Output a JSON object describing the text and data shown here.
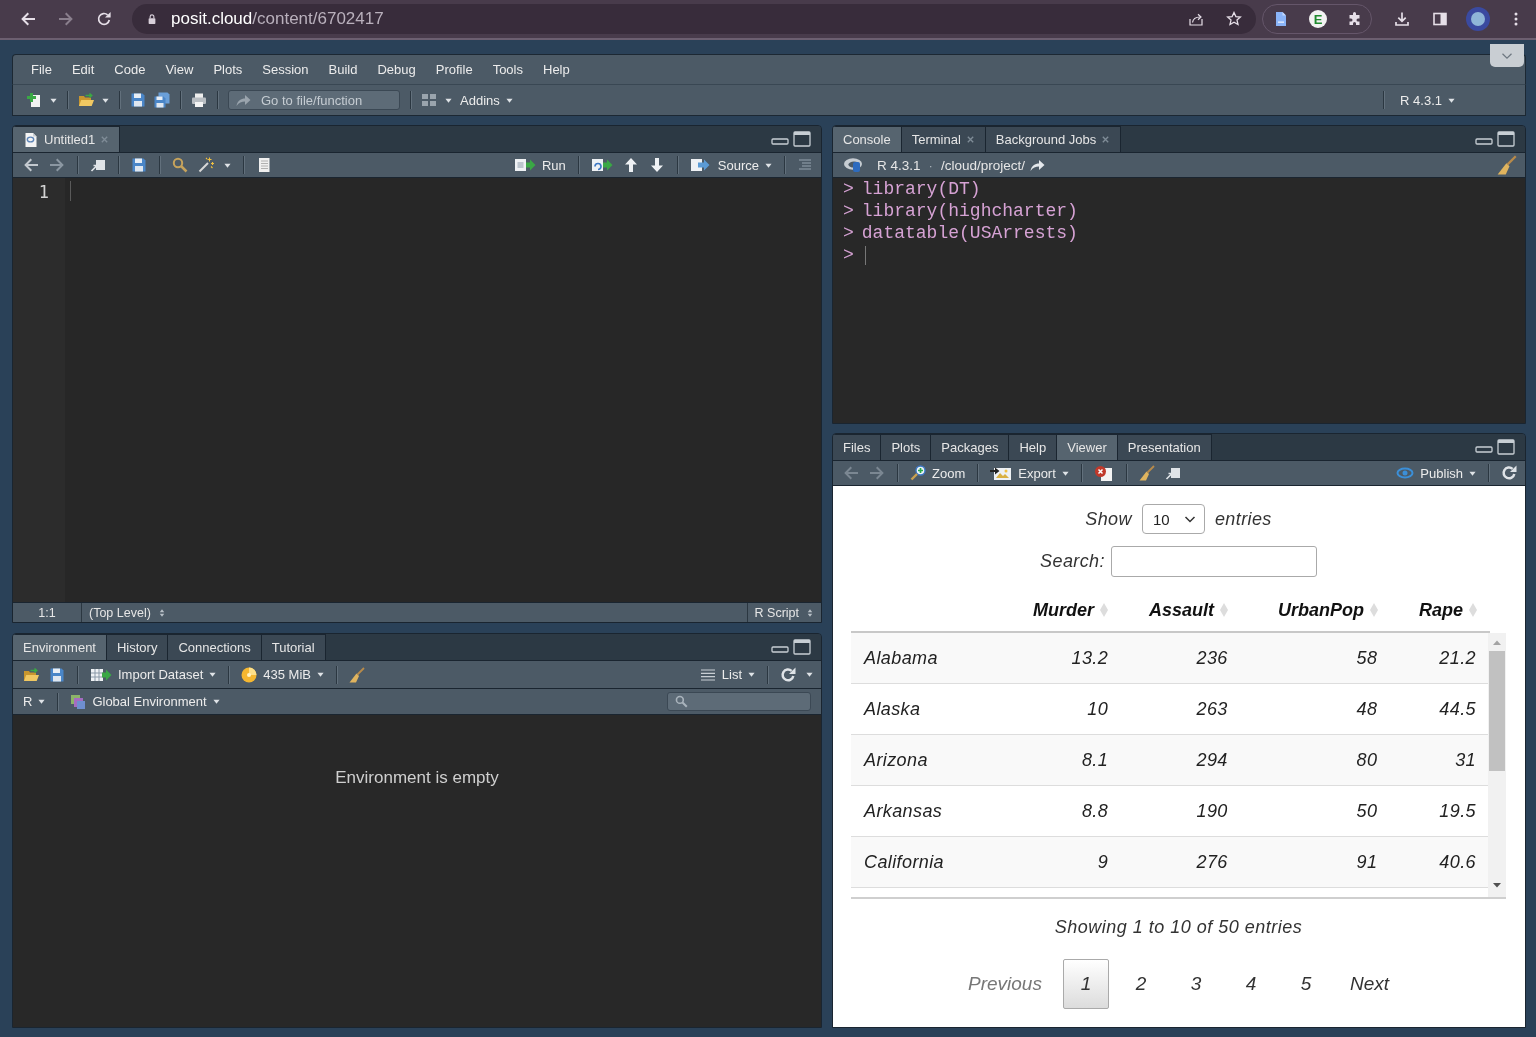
{
  "browser": {
    "forward_disabled": true,
    "url_host": "posit.cloud",
    "url_path": "/content/6702417",
    "extension_letter": "E"
  },
  "menu": [
    "File",
    "Edit",
    "Code",
    "View",
    "Plots",
    "Session",
    "Build",
    "Debug",
    "Profile",
    "Tools",
    "Help"
  ],
  "main_toolbar": {
    "goto_placeholder": "Go to file/function",
    "addins": "Addins",
    "r_version": "R 4.3.1"
  },
  "source_pane": {
    "tabs": [
      {
        "label": "Untitled1",
        "selected": true,
        "closable": true
      }
    ],
    "run": "Run",
    "source": "Source",
    "line_numbers": [
      "1"
    ],
    "cursor_position": "1:1",
    "scope": "(Top Level)",
    "file_type": "R Script"
  },
  "console_pane": {
    "tabs": [
      {
        "label": "Console",
        "selected": true,
        "closable": false
      },
      {
        "label": "Terminal",
        "selected": false,
        "closable": true
      },
      {
        "label": "Background Jobs",
        "selected": false,
        "closable": true
      }
    ],
    "r_version": "R 4.3.1",
    "separator": "·",
    "working_dir": "/cloud/project/",
    "lines": [
      {
        "prompt": ">",
        "code": "library(DT)"
      },
      {
        "prompt": ">",
        "code": "library(highcharter)"
      },
      {
        "prompt": ">",
        "code": "datatable(USArrests)"
      }
    ],
    "input_prompt": ">"
  },
  "environment_pane": {
    "tabs": [
      {
        "label": "Environment",
        "selected": true
      },
      {
        "label": "History",
        "selected": false
      },
      {
        "label": "Connections",
        "selected": false
      },
      {
        "label": "Tutorial",
        "selected": false
      }
    ],
    "import_dataset": "Import Dataset",
    "memory": "435 MiB",
    "view_mode": "List",
    "language": "R",
    "environment": "Global Environment",
    "message": "Environment is empty"
  },
  "viewer_pane": {
    "tabs": [
      {
        "label": "Files",
        "selected": false
      },
      {
        "label": "Plots",
        "selected": false
      },
      {
        "label": "Packages",
        "selected": false
      },
      {
        "label": "Help",
        "selected": false
      },
      {
        "label": "Viewer",
        "selected": true
      },
      {
        "label": "Presentation",
        "selected": false
      }
    ],
    "history_disabled": true,
    "zoom": "Zoom",
    "export": "Export",
    "publish": "Publish",
    "datatable": {
      "show_label": "Show",
      "page_length": "10",
      "entries_label": "entries",
      "search_label": "Search:",
      "columns": [
        "Murder",
        "Assault",
        "UrbanPop",
        "Rape"
      ],
      "rows": [
        {
          "name": "Alabama",
          "values": [
            "13.2",
            "236",
            "58",
            "21.2"
          ]
        },
        {
          "name": "Alaska",
          "values": [
            "10",
            "263",
            "48",
            "44.5"
          ]
        },
        {
          "name": "Arizona",
          "values": [
            "8.1",
            "294",
            "80",
            "31"
          ]
        },
        {
          "name": "Arkansas",
          "values": [
            "8.8",
            "190",
            "50",
            "19.5"
          ]
        },
        {
          "name": "California",
          "values": [
            "9",
            "276",
            "91",
            "40.6"
          ]
        }
      ],
      "info": "Showing 1 to 10 of 50 entries",
      "previous": {
        "label": "Previous",
        "disabled": true
      },
      "pages": [
        {
          "label": "1",
          "selected": true
        },
        {
          "label": "2",
          "selected": false
        },
        {
          "label": "3",
          "selected": false
        },
        {
          "label": "4",
          "selected": false
        },
        {
          "label": "5",
          "selected": false
        }
      ],
      "next": {
        "label": "Next",
        "disabled": false
      }
    }
  }
}
